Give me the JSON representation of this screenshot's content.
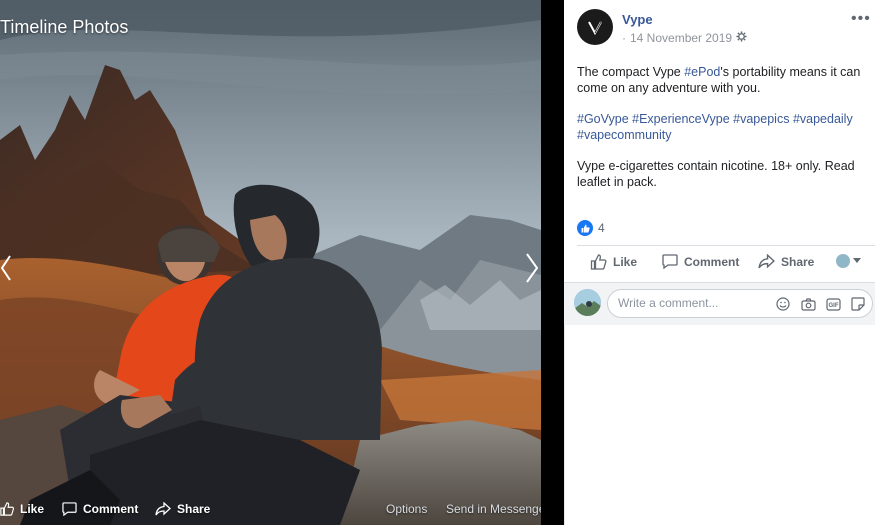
{
  "viewer": {
    "title": "Timeline Photos",
    "actions": {
      "like": "Like",
      "comment": "Comment",
      "share": "Share",
      "options": "Options",
      "send": "Send in Messenger"
    }
  },
  "post": {
    "page_name": "Vype",
    "date": "14 November 2019",
    "separator": "·",
    "privacy_icon": "globe-settings-icon",
    "text_line1_a": "The compact Vype ",
    "text_line1_tag": "#ePod",
    "text_line1_b": "'s portability means it can come on any adventure with you.",
    "hashtags": [
      "#GoVype",
      "#ExperienceVype",
      "#vapepics",
      "#vapedaily",
      "#vapecommunity"
    ],
    "warning": "Vype e-cigarettes contain nicotine. 18+ only. Read leaflet in pack.",
    "reaction_count": "4"
  },
  "actions": {
    "like": "Like",
    "comment": "Comment",
    "share": "Share"
  },
  "comment": {
    "placeholder": "Write a comment..."
  },
  "colors": {
    "link": "#385898",
    "like_blue": "#1877f2",
    "muted": "#606770"
  }
}
